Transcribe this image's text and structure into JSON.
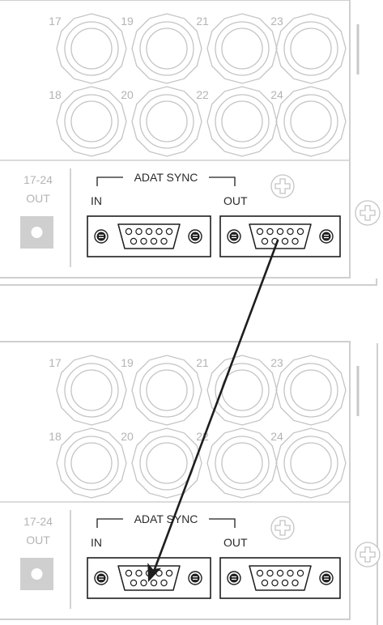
{
  "devices": [
    {
      "name": "top-unit",
      "jack_labels_top": [
        "17",
        "19",
        "21",
        "23"
      ],
      "jack_labels_bottom": [
        "18",
        "20",
        "22",
        "24"
      ],
      "out_group_label": "17-24",
      "out_label": "OUT",
      "sync_title": "ADAT SYNC",
      "in_label": "IN",
      "out_port_label": "OUT"
    },
    {
      "name": "bottom-unit",
      "jack_labels_top": [
        "17",
        "19",
        "21",
        "23"
      ],
      "jack_labels_bottom": [
        "18",
        "20",
        "22",
        "24"
      ],
      "out_group_label": "17-24",
      "out_label": "OUT",
      "sync_title": "ADAT SYNC",
      "in_label": "IN",
      "out_port_label": "OUT"
    }
  ],
  "connection": {
    "from": "top-unit ADAT SYNC OUT",
    "to": "bottom-unit ADAT SYNC IN"
  },
  "colors": {
    "line": "#c4c4c4",
    "ink": "#1e1e1e",
    "panel": "#ffffff",
    "button": "#cfcfcf"
  }
}
